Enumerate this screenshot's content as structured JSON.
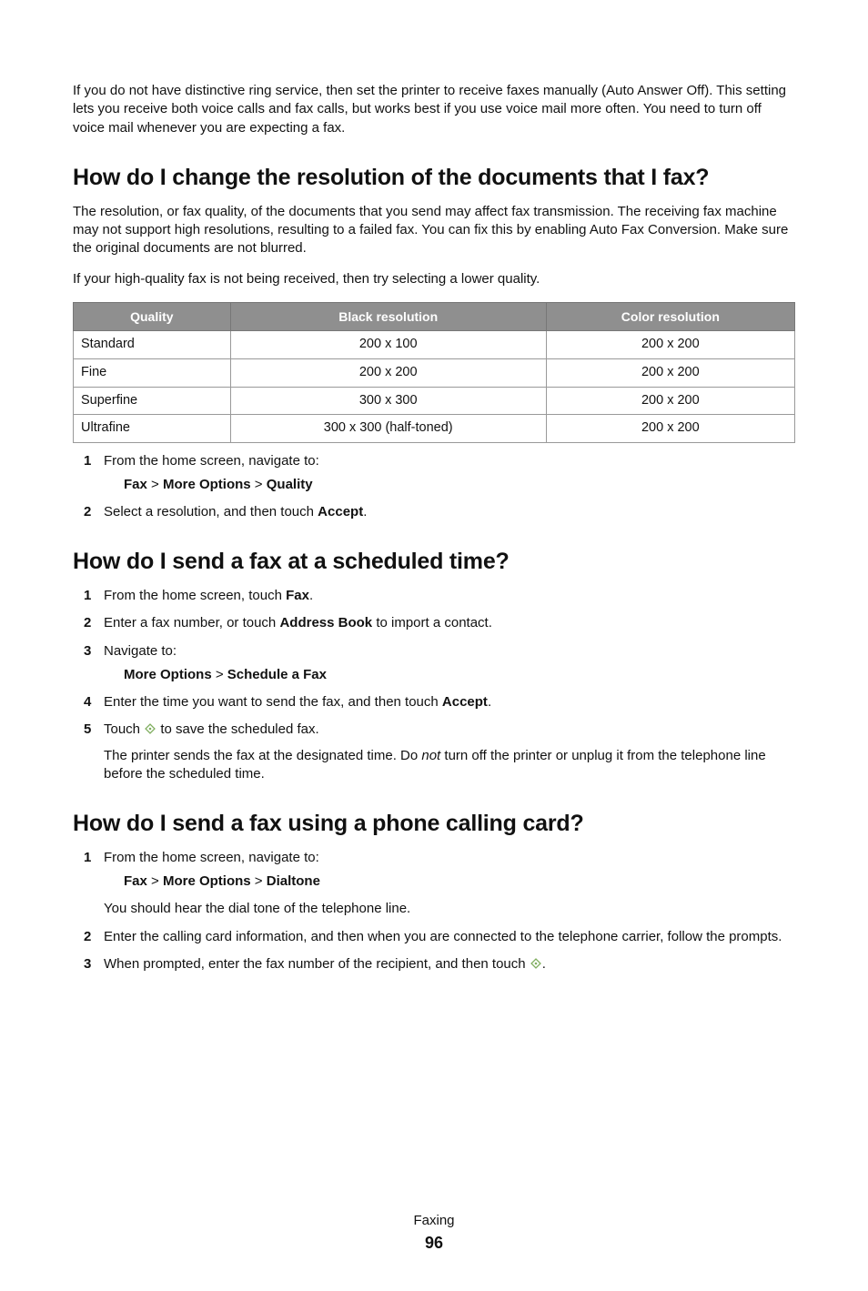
{
  "intro_paragraph": "If you do not have distinctive ring service, then set the printer to receive faxes manually (Auto Answer Off). This setting lets you receive both voice calls and fax calls, but works best if you use voice mail more often. You need to turn off voice mail whenever you are expecting a fax.",
  "section_resolution": {
    "heading": "How do I change the resolution of the documents that I fax?",
    "para1": "The resolution, or fax quality, of the documents that you send may affect fax transmission. The receiving fax machine may not support high resolutions, resulting to a failed fax. You can fix this by enabling Auto Fax Conversion. Make sure the original documents are not blurred.",
    "para2": "If your high-quality fax is not being received, then try selecting a lower quality.",
    "table": {
      "headers": {
        "quality": "Quality",
        "black": "Black resolution",
        "color": "Color resolution"
      },
      "rows": [
        {
          "quality": "Standard",
          "black": "200 x 100",
          "color": "200 x 200"
        },
        {
          "quality": "Fine",
          "black": "200 x 200",
          "color": "200 x 200"
        },
        {
          "quality": "Superfine",
          "black": "300 x 300",
          "color": "200 x 200"
        },
        {
          "quality": "Ultrafine",
          "black": "300 x 300 (half-toned)",
          "color": "200 x 200"
        }
      ]
    },
    "step1": "From the home screen, navigate to:",
    "path1_a": "Fax",
    "path1_gt1": " > ",
    "path1_b": "More Options",
    "path1_gt2": " > ",
    "path1_c": "Quality",
    "step2_pre": "Select a resolution, and then touch ",
    "step2_bold": "Accept",
    "step2_post": "."
  },
  "section_schedule": {
    "heading": "How do I send a fax at a scheduled time?",
    "step1_pre": "From the home screen, touch ",
    "step1_bold": "Fax",
    "step1_post": ".",
    "step2_pre": "Enter a fax number, or touch ",
    "step2_bold": "Address Book",
    "step2_post": " to import a contact.",
    "step3": "Navigate to:",
    "path_a": "More Options",
    "path_gt": " > ",
    "path_b": "Schedule a Fax",
    "step4_pre": "Enter the time you want to send the fax, and then touch ",
    "step4_bold": "Accept",
    "step4_post": ".",
    "step5_pre": "Touch ",
    "step5_post": " to save the scheduled fax.",
    "note_pre": "The printer sends the fax at the designated time. Do ",
    "note_ital": "not",
    "note_post": " turn off the printer or unplug it from the telephone line before the scheduled time."
  },
  "section_card": {
    "heading": "How do I send a fax using a phone calling card?",
    "step1": "From the home screen, navigate to:",
    "path_a": "Fax",
    "path_gt1": " > ",
    "path_b": "More Options",
    "path_gt2": " > ",
    "path_c": "Dialtone",
    "sub1": "You should hear the dial tone of the telephone line.",
    "step2": "Enter the calling card information, and then when you are connected to the telephone carrier, follow the prompts.",
    "step3_pre": "When prompted, enter the fax number of the recipient, and then touch ",
    "step3_post": "."
  },
  "footer": {
    "section": "Faxing",
    "page": "96"
  }
}
